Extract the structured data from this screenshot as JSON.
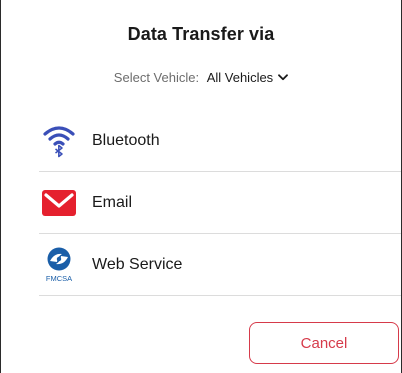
{
  "dialog": {
    "title": "Data Transfer via",
    "vehicle_label": "Select Vehicle:",
    "vehicle_value": "All Vehicles",
    "vehicle_icon": "chevron-down-icon",
    "options": [
      {
        "label": "Bluetooth",
        "icon": "bluetooth-icon"
      },
      {
        "label": "Email",
        "icon": "email-icon"
      },
      {
        "label": "Web Service",
        "icon": "fmcsa-logo-icon",
        "logo_text": "FMCSA"
      }
    ],
    "cancel_label": "Cancel"
  },
  "colors": {
    "accent": "#d63a4a",
    "bluetooth_blue": "#3a4fb8",
    "email_red": "#e5202e",
    "fmcsa_blue": "#1a5ea8"
  }
}
